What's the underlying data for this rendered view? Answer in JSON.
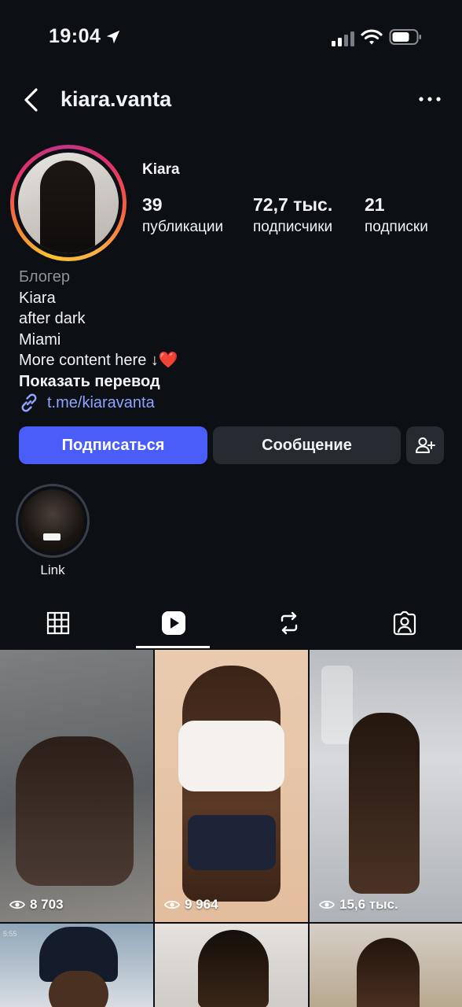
{
  "status_bar": {
    "time": "19:04"
  },
  "header": {
    "username": "kiara.vanta"
  },
  "profile": {
    "name": "Kiara",
    "stats": [
      {
        "value": "39",
        "label": "публикации"
      },
      {
        "value": "72,7 тыс.",
        "label": "подписчики"
      },
      {
        "value": "21",
        "label": "подписки"
      }
    ],
    "bio": {
      "category": "Блогер",
      "lines": [
        "Kiara",
        "after dark",
        "Miami"
      ],
      "more_text": "More content here ↓",
      "heart": "❤️",
      "translate": "Показать перевод",
      "link": "t.me/kiaravanta"
    }
  },
  "actions": {
    "follow": "Подписаться",
    "message": "Сообщение"
  },
  "highlights": [
    {
      "label": "Link"
    }
  ],
  "tabs": [
    {
      "icon": "grid-icon",
      "active": false
    },
    {
      "icon": "reels-icon",
      "active": true
    },
    {
      "icon": "reposts-icon",
      "active": false
    },
    {
      "icon": "tagged-icon",
      "active": false
    }
  ],
  "reels": [
    {
      "views": "8 703"
    },
    {
      "views": "9 964"
    },
    {
      "views": "15,6 тыс."
    },
    {
      "views": "",
      "time": "5:55"
    },
    {
      "views": ""
    },
    {
      "views": ""
    }
  ],
  "colors": {
    "background": "#0c0f14",
    "follow_button": "#4a5df9",
    "secondary_button": "#262a31",
    "link": "#8fa4ff"
  }
}
